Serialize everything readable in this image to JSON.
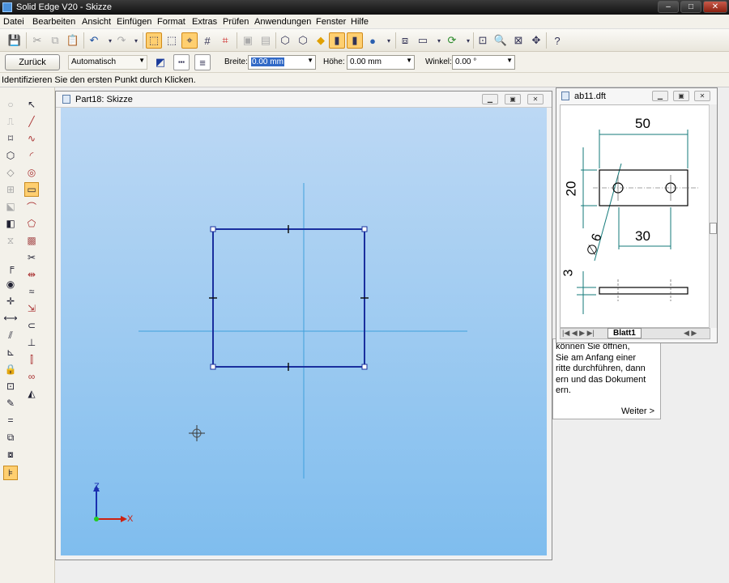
{
  "window": {
    "title": "Solid Edge V20 - Skizze"
  },
  "menu": [
    "Datei",
    "Bearbeiten",
    "Ansicht",
    "Einfügen",
    "Format",
    "Extras",
    "Prüfen",
    "Anwendungen",
    "Fenster",
    "Hilfe"
  ],
  "ribbon": {
    "back_label": "Zurück",
    "mode_value": "Automatisch",
    "width_label": "Breite:",
    "width_value": "0.00 mm",
    "height_label": "Höhe:",
    "height_value": "0.00 mm",
    "angle_label": "Winkel:",
    "angle_value": "0.00 °"
  },
  "status_text": "Identifizieren Sie den ersten Punkt durch Klicken.",
  "sketch_window": {
    "title": "Part18: Skizze"
  },
  "axes": {
    "z": "Z",
    "x": "X"
  },
  "drawing_window": {
    "title": "ab11.dft",
    "sheet_tab": "Blatt1",
    "dims": {
      "d50": "50",
      "d20": "20",
      "d30": "30",
      "d6": "∅ 6",
      "d3": "3"
    }
  },
  "help_panel": {
    "lines": [
      "können Sie öffnen,",
      "Sie am Anfang einer",
      "ritte durchführen, dann",
      "ern und das Dokument",
      "ern."
    ],
    "next_label": "Weiter >"
  },
  "colors": {
    "accent": "#ffcf70",
    "sketch_line": "#1a2f9e",
    "axis_line": "#3fa0dc"
  }
}
